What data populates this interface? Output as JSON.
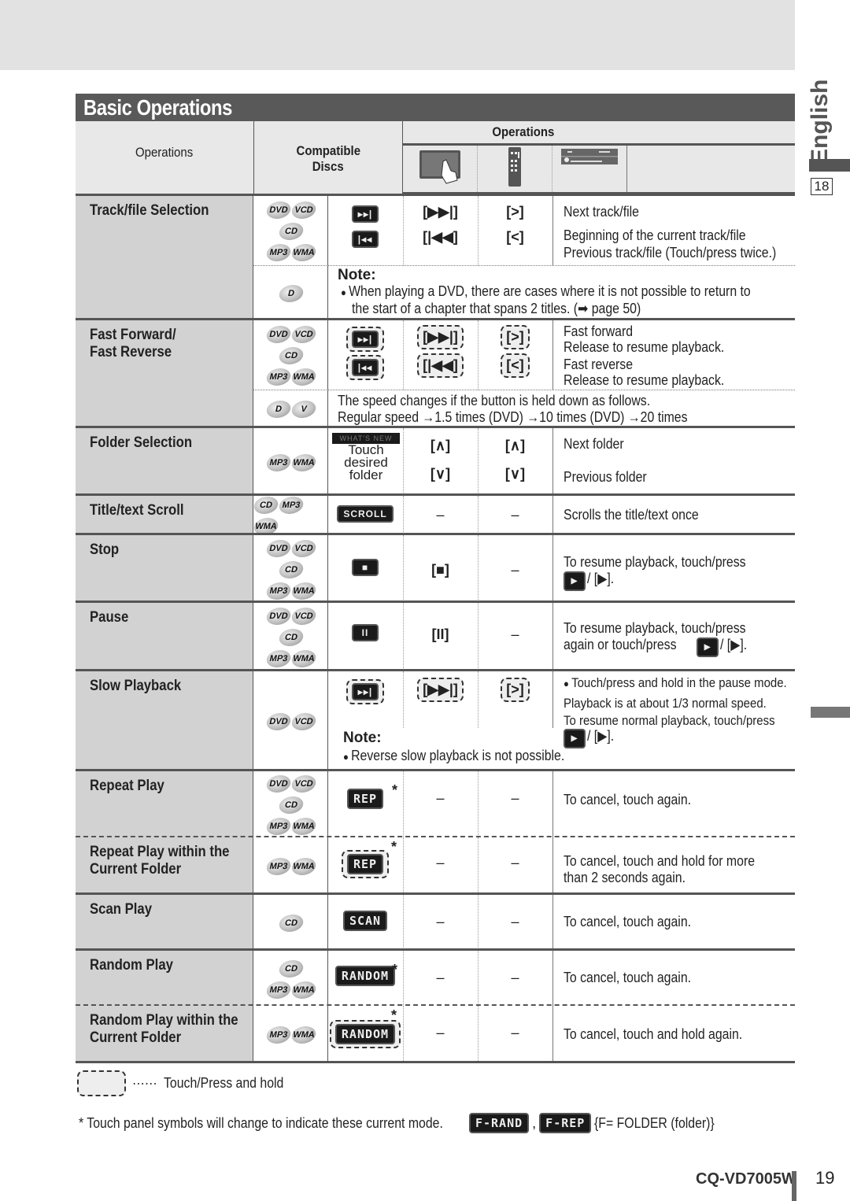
{
  "sidebar": {
    "language": "English",
    "section_page": "18"
  },
  "title": "Basic Operations",
  "header": {
    "operations_col": "Operations",
    "compatible_discs": [
      "Compatible",
      "Discs"
    ],
    "operations_group": "Operations",
    "icons": [
      "touch-panel-icon",
      "remote-control-icon",
      "head-unit-icon"
    ]
  },
  "rows": [
    {
      "name": "Track/file Selection",
      "discs": [
        [
          "DVD",
          "VCD"
        ],
        [
          "CD"
        ],
        [
          "MP3",
          "WMA"
        ]
      ],
      "lines": [
        {
          "touch": "▸▸|",
          "remote": "[▶▶|]",
          "unit": "[>]",
          "desc": "Next track/file"
        },
        {
          "touch": "|◂◂",
          "remote": "[|◀◀]",
          "unit": "[<]",
          "desc": "Beginning of the current track/file",
          "desc2": "Previous track/file (Touch/press twice.)"
        }
      ],
      "note": {
        "discs": [
          "DVD"
        ],
        "title": "Note:",
        "text": "When playing a DVD, there are cases where it is not possible to return to",
        "text2": "the start of a chapter that spans 2 titles. (➡ page 50)"
      }
    },
    {
      "name": "Fast Forward/",
      "name2": "Fast Reverse",
      "discs": [
        [
          "DVD",
          "VCD"
        ],
        [
          "CD"
        ],
        [
          "MP3",
          "WMA"
        ]
      ],
      "lines": [
        {
          "touch": "▸▸|",
          "remote": "[▶▶|]",
          "unit": "[>]",
          "desc": "Fast forward",
          "desc2": "Release to resume playback."
        },
        {
          "touch": "|◂◂",
          "remote": "[|◀◀]",
          "unit": "[<]",
          "desc": "Fast reverse",
          "desc2": "Release to resume playback."
        }
      ],
      "note": {
        "discs": [
          "DVD",
          "VCD"
        ],
        "text": "The speed changes if the button is held down as follows.",
        "text2": "Regular speed →1.5 times (DVD) →10 times (DVD) →20 times"
      }
    },
    {
      "name": "Folder Selection",
      "discs": [
        [
          "MP3",
          "WMA"
        ]
      ],
      "touch_strip": "WHAT'S NEW",
      "touch_text": [
        "Touch",
        "desired",
        "folder"
      ],
      "lines": [
        {
          "remote": "[∧]",
          "unit": "[∧]",
          "desc": "Next folder"
        },
        {
          "remote": "[∨]",
          "unit": "[∨]",
          "desc": "Previous folder"
        }
      ]
    },
    {
      "name": "Title/text Scroll",
      "discs": [
        [
          "CD",
          "MP3",
          "WMA"
        ]
      ],
      "touch": "SCROLL",
      "remote": "–",
      "unit": "–",
      "desc": "Scrolls the title/text once"
    },
    {
      "name": "Stop",
      "discs": [
        [
          "DVD",
          "VCD"
        ],
        [
          "CD"
        ],
        [
          "MP3",
          "WMA"
        ]
      ],
      "touch": "■",
      "remote": "[■]",
      "unit": "–",
      "desc": "To resume playback, touch/press",
      "desc2": "/ [▶]."
    },
    {
      "name": "Pause",
      "discs": [
        [
          "DVD",
          "VCD"
        ],
        [
          "CD"
        ],
        [
          "MP3",
          "WMA"
        ]
      ],
      "touch": "II",
      "remote": "[II]",
      "unit": "–",
      "desc": "To resume playback, touch/press",
      "desc2": "again or touch/press",
      "desc3": "/ [▶]."
    },
    {
      "name": "Slow Playback",
      "discs": [
        [
          "DVD",
          "VCD"
        ]
      ],
      "touch": "▸▸|",
      "remote": "[▶▶|]",
      "unit": "[>]",
      "desc": "Touch/press and hold in the pause mode.",
      "desc2": "Playback is at about 1/3 normal speed.",
      "desc3": "To resume normal playback, touch/press",
      "desc4": "/ [▶].",
      "note": {
        "title": "Note:",
        "text": "Reverse slow playback is not possible."
      }
    },
    {
      "name": "Repeat Play",
      "discs": [
        [
          "DVD",
          "VCD"
        ],
        [
          "CD"
        ],
        [
          "MP3",
          "WMA"
        ]
      ],
      "touch": "REP",
      "remote": "–",
      "unit": "–",
      "desc": "To cancel, touch again."
    },
    {
      "name": "Repeat Play within the",
      "name2": "Current Folder",
      "discs": [
        [
          "MP3",
          "WMA"
        ]
      ],
      "touch": "REP",
      "remote": "–",
      "unit": "–",
      "desc": "To cancel, touch and hold for more",
      "desc2": "than 2 seconds again."
    },
    {
      "name": "Scan Play",
      "discs": [
        [
          "CD"
        ]
      ],
      "touch": "SCAN",
      "remote": "–",
      "unit": "–",
      "desc": "To cancel, touch again."
    },
    {
      "name": "Random Play",
      "discs": [
        [
          "CD"
        ],
        [
          "MP3",
          "WMA"
        ]
      ],
      "touch": "RANDOM",
      "remote": "–",
      "unit": "–",
      "desc": "To cancel, touch again."
    },
    {
      "name": "Random Play within the",
      "name2": "Current Folder",
      "discs": [
        [
          "MP3",
          "WMA"
        ]
      ],
      "touch": "RANDOM",
      "remote": "–",
      "unit": "–",
      "desc": "To cancel, touch and hold again."
    }
  ],
  "star": "*",
  "legend": {
    "dots": "······",
    "text": "Touch/Press and hold"
  },
  "footnote": {
    "text": "* Touch panel symbols will change to indicate these current mode.",
    "btn1": "F-RAND",
    "sep": ",",
    "btn2": "F-REP",
    "suffix": "{F= FOLDER (folder)}"
  },
  "footer": {
    "model": "CQ-VD7005W",
    "page": "19"
  }
}
